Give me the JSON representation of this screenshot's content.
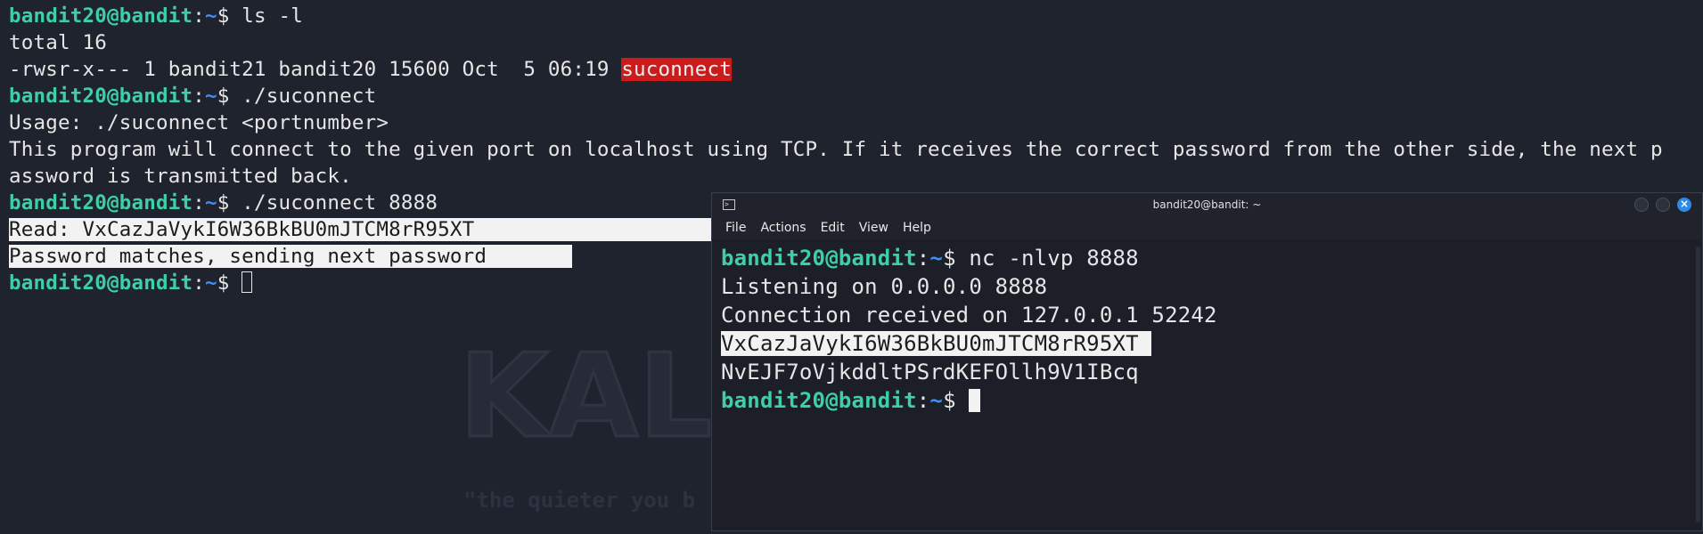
{
  "background_terminal": {
    "prompt": {
      "user": "bandit20@bandit",
      "colon": ":",
      "path": "~",
      "symbol": "$ "
    },
    "line1_cmd": "ls -l",
    "line2": "total 16",
    "line3_prefix": "-rwsr-x--- 1 bandit21 bandit20 15600 Oct  5 06:19 ",
    "line3_file": "suconnect",
    "line4_cmd": "./suconnect",
    "line5": "Usage: ./suconnect <portnumber>",
    "line6": "This program will connect to the given port on localhost using TCP. If it receives the correct password from the other side, the next p",
    "line7": "assword is transmitted back.",
    "line8_cmd": "./suconnect 8888",
    "line9": "Read: VxCazJaVykI6W36BkBU0mJTCM8rR95XT                        ",
    "line10": "Password matches, sending next password       "
  },
  "wallpaper": {
    "logo_text": "KALI",
    "tagline": "\"the quieter you b"
  },
  "terminal_window": {
    "title": "bandit20@bandit: ~",
    "menu": [
      "File",
      "Actions",
      "Edit",
      "View",
      "Help"
    ],
    "line1_cmd": "nc -nlvp 8888",
    "line2": "Listening on 0.0.0.0 8888",
    "line3": "Connection received on 127.0.0.1 52242",
    "line4": "VxCazJaVykI6W36BkBU0mJTCM8rR95XT ",
    "line5": "NvEJF7oVjkddltPSrdKEFOllh9V1IBcq"
  },
  "colors": {
    "prompt_user": "#3dd0a6",
    "prompt_path": "#3d8ff2",
    "executable_highlight": "#cc1b1b",
    "close_button": "#2a8ce8"
  }
}
